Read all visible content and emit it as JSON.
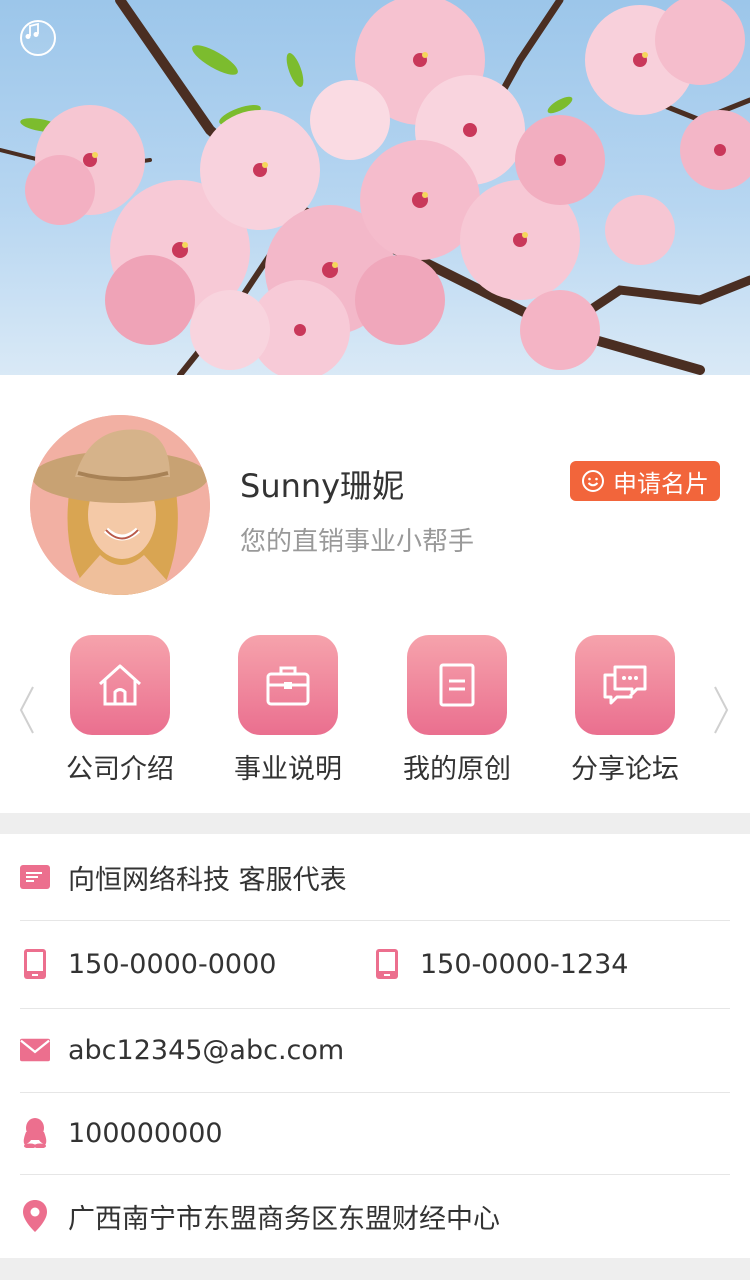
{
  "profile": {
    "name": "Sunny珊妮",
    "tagline": "您的直销事业小帮手",
    "apply_label": "申请名片"
  },
  "nav": {
    "items": [
      {
        "label": "公司介绍",
        "icon": "home-icon"
      },
      {
        "label": "事业说明",
        "icon": "briefcase-icon"
      },
      {
        "label": "我的原创",
        "icon": "document-icon"
      },
      {
        "label": "分享论坛",
        "icon": "chat-icon"
      }
    ]
  },
  "contact": {
    "company": "向恒网络科技 客服代表",
    "phone1": "150-0000-0000",
    "phone2": "150-0000-1234",
    "email": "abc12345@abc.com",
    "qq": "100000000",
    "address": "广西南宁市东盟商务区东盟财经中心"
  },
  "icons": {
    "music": "music-note-icon",
    "company": "card-icon",
    "phone": "mobile-phone-icon",
    "email": "envelope-icon",
    "qq": "qq-penguin-icon",
    "address": "location-pin-icon",
    "apply": "smile-icon",
    "arrows": [
      "chevron-left-icon",
      "chevron-right-icon"
    ]
  },
  "colors": {
    "accent_pink": "#ea6f8f",
    "accent_pink_light": "#f6a3ac",
    "apply_orange": "#f2653b",
    "text_dark": "#333333",
    "text_muted": "#999999",
    "divider": "#e6e6e6",
    "page_bg": "#eeeeee"
  }
}
